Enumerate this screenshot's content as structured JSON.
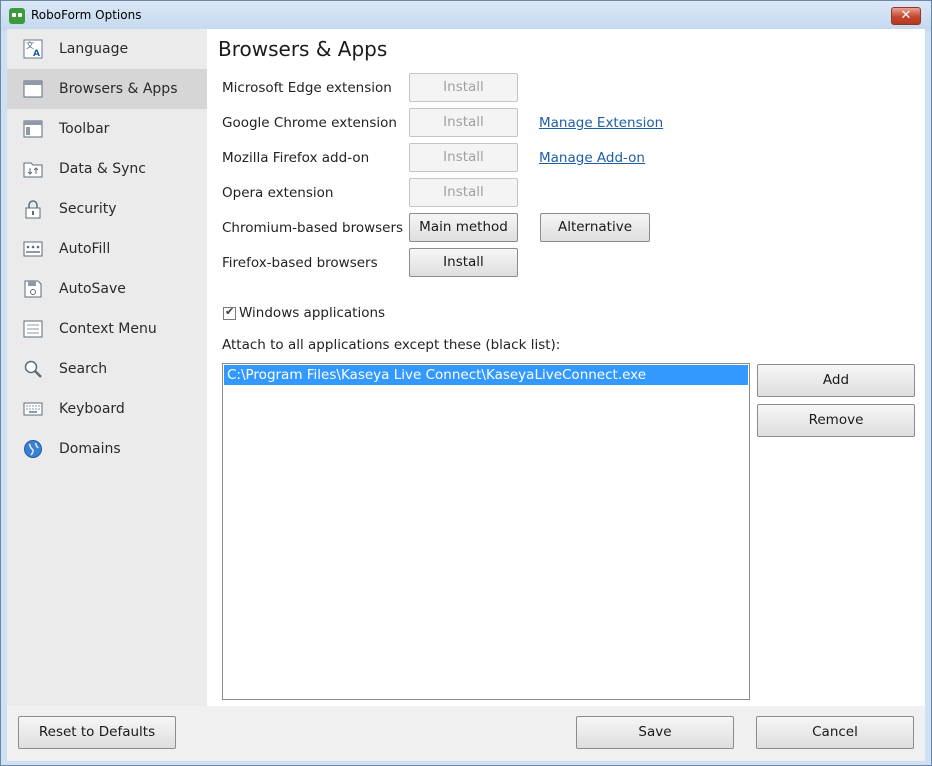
{
  "window": {
    "title": "RoboForm Options",
    "close_glyph": "✕",
    "icon": "roboform-app-icon"
  },
  "sidebar": {
    "items": [
      {
        "label": "Language",
        "icon": "language-icon",
        "active": false
      },
      {
        "label": "Browsers & Apps",
        "icon": "browser-window-icon",
        "active": true
      },
      {
        "label": "Toolbar",
        "icon": "toolbar-icon",
        "active": false
      },
      {
        "label": "Data & Sync",
        "icon": "data-sync-icon",
        "active": false
      },
      {
        "label": "Security",
        "icon": "lock-icon",
        "active": false
      },
      {
        "label": "AutoFill",
        "icon": "autofill-icon",
        "active": false
      },
      {
        "label": "AutoSave",
        "icon": "floppy-disk-icon",
        "active": false
      },
      {
        "label": "Context Menu",
        "icon": "context-menu-icon",
        "active": false
      },
      {
        "label": "Search",
        "icon": "magnifier-icon",
        "active": false
      },
      {
        "label": "Keyboard",
        "icon": "keyboard-icon",
        "active": false
      },
      {
        "label": "Domains",
        "icon": "globe-icon",
        "active": false
      }
    ]
  },
  "main": {
    "title": "Browsers & Apps",
    "rows": [
      {
        "label": "Microsoft Edge extension",
        "button": "Install",
        "button_enabled": false,
        "link": ""
      },
      {
        "label": "Google Chrome extension",
        "button": "Install",
        "button_enabled": false,
        "link": "Manage Extension"
      },
      {
        "label": "Mozilla Firefox add-on",
        "button": "Install",
        "button_enabled": false,
        "link": "Manage Add-on"
      },
      {
        "label": "Opera extension",
        "button": "Install",
        "button_enabled": false,
        "link": ""
      },
      {
        "label": "Chromium-based browsers",
        "button": "Main method",
        "button_enabled": true,
        "secondary_button": "Alternative"
      },
      {
        "label": "Firefox-based browsers",
        "button": "Install",
        "button_enabled": true,
        "link": ""
      }
    ],
    "windows_apps": {
      "label": "Windows applications",
      "checked": true
    },
    "blacklist_caption": "Attach to all applications except these (black list):",
    "blacklist_items": [
      "C:\\Program Files\\Kaseya Live Connect\\KaseyaLiveConnect.exe"
    ],
    "add_label": "Add",
    "remove_label": "Remove"
  },
  "footer": {
    "reset_label": "Reset to Defaults",
    "save_label": "Save",
    "cancel_label": "Cancel"
  },
  "colors": {
    "selection": "#3399ff",
    "link": "#1f5ea8",
    "sidebar_bg": "#ebebeb",
    "sidebar_active": "#d6d6d6",
    "titlebar": "#cfe0f2"
  }
}
